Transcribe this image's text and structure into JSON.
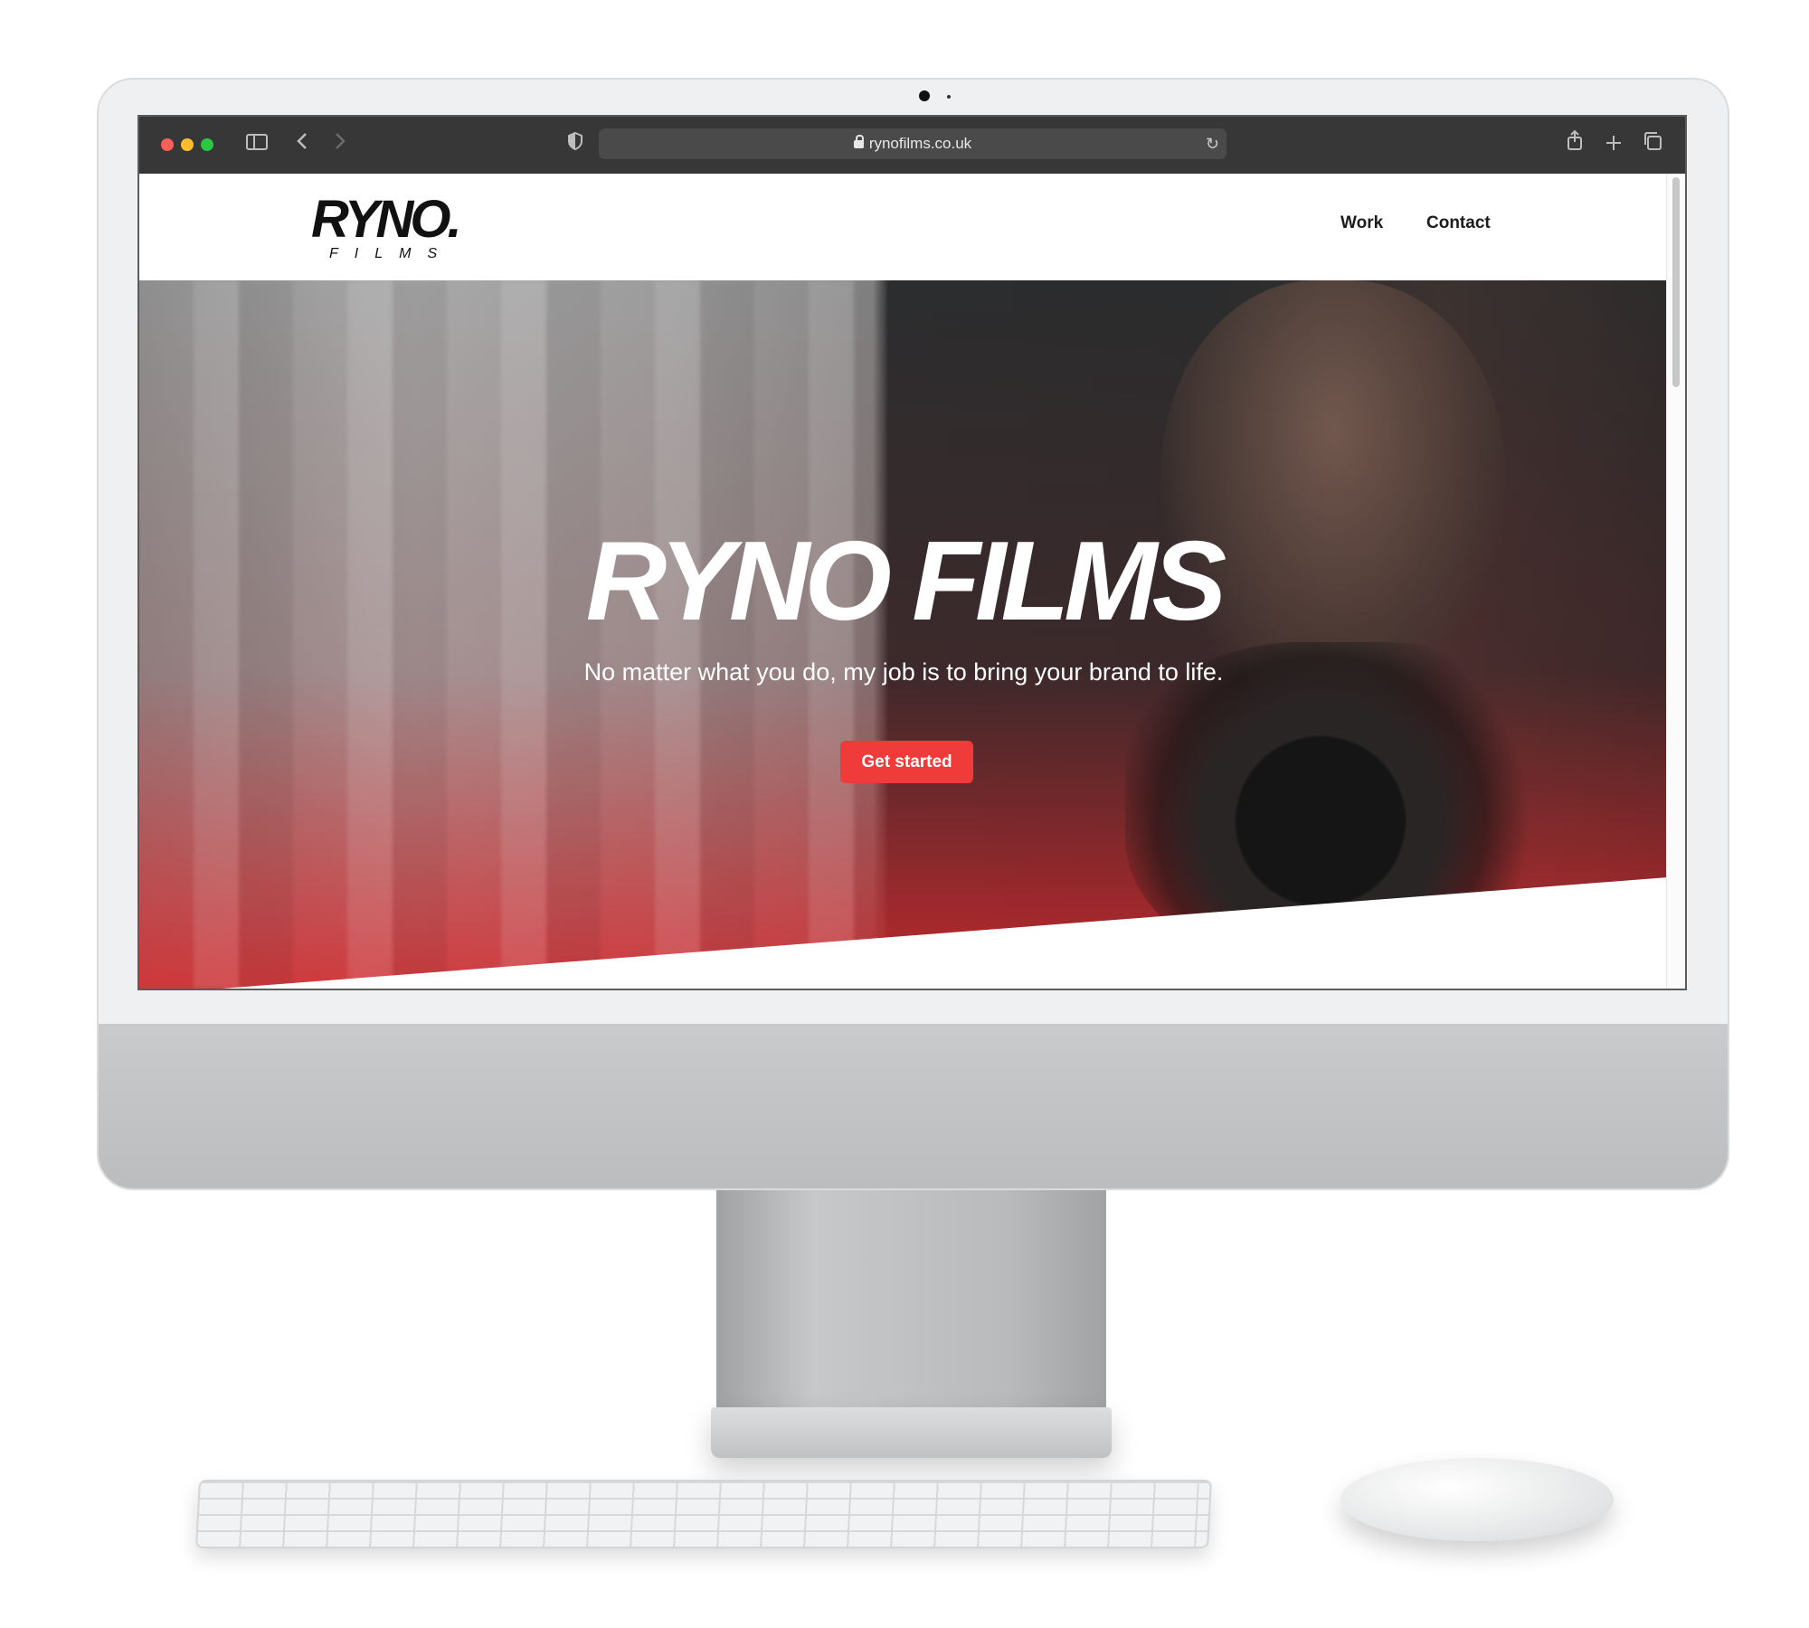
{
  "browser": {
    "url": "rynofilms.co.uk",
    "icons": [
      "sidebar-icon",
      "back-icon",
      "forward-icon",
      "shield-icon",
      "lock-icon",
      "reload-icon",
      "share-icon",
      "new-tab-icon",
      "tabs-overview-icon"
    ]
  },
  "site": {
    "logo_main": "RYNO.",
    "logo_sub": "FILMS",
    "nav": [
      "Work",
      "Contact"
    ],
    "hero_title": "RYNO FILMS",
    "hero_subtitle": "No matter what you do, my job is to bring your brand to life.",
    "cta_label": "Get started"
  },
  "colors": {
    "accent": "#f03b3b",
    "toolbar": "#373737"
  }
}
